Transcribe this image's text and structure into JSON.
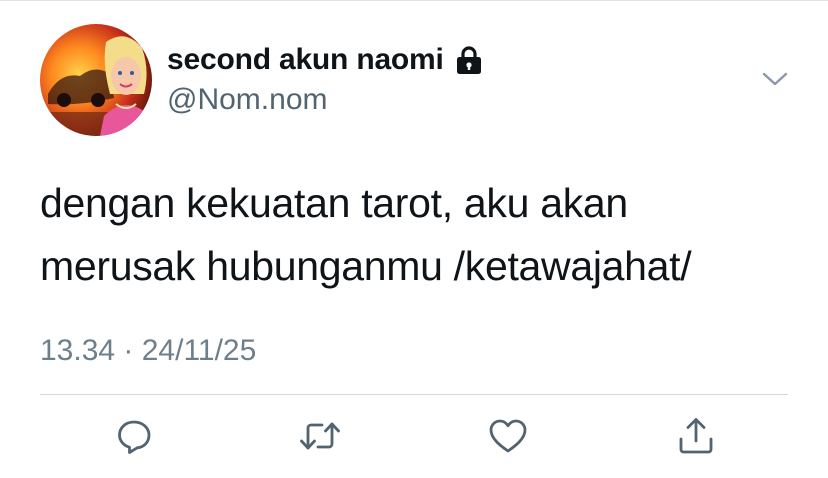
{
  "user": {
    "display_name": "second akun naomi",
    "handle": "@Nom.nom",
    "protected_icon": "lock-icon"
  },
  "tweet": {
    "lines": [
      "dengan kekuatan tarot, aku akan",
      "merusak hubunganmu /ketawajahat/"
    ],
    "timestamp": "13.34 · 24/11/25"
  },
  "actions": [
    {
      "name": "reply",
      "icon": "reply-icon"
    },
    {
      "name": "retweet",
      "icon": "retweet-icon"
    },
    {
      "name": "like",
      "icon": "heart-icon"
    },
    {
      "name": "share",
      "icon": "share-icon"
    }
  ],
  "colors": {
    "text": "#0f1419",
    "secondary": "#536471",
    "icon": "#536471",
    "divider": "#cfd9de"
  }
}
